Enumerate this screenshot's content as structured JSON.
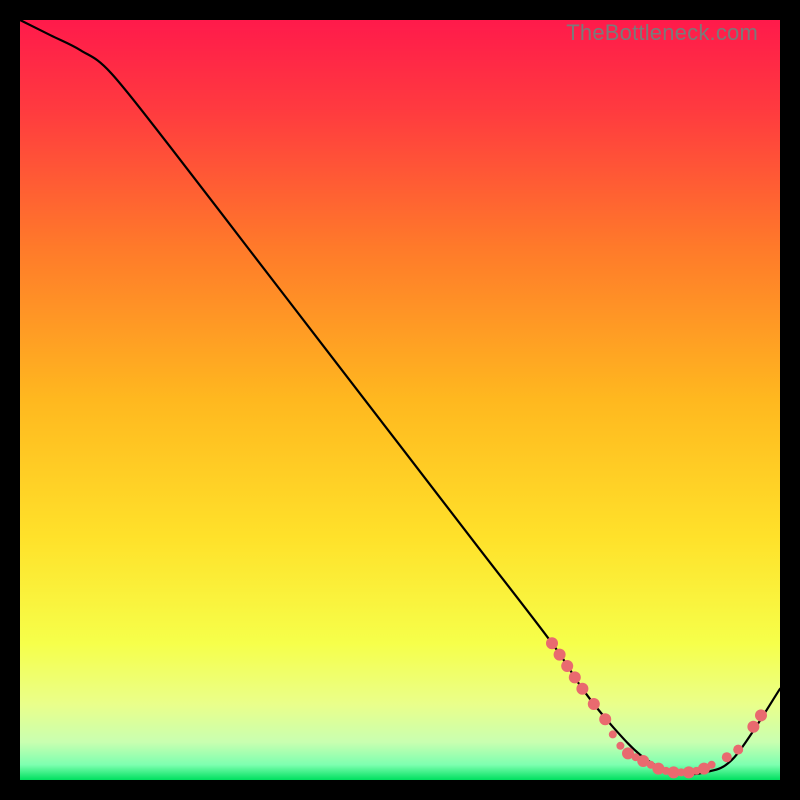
{
  "watermark": "TheBottleneck.com",
  "chart_data": {
    "type": "line",
    "title": "",
    "xlabel": "",
    "ylabel": "",
    "xlim": [
      0,
      100
    ],
    "ylim": [
      0,
      100
    ],
    "grid": false,
    "legend": false,
    "background_gradient": {
      "top_color": "#ff1a4b",
      "mid_color": "#ffd400",
      "bottom_band_color": "#eaff8a",
      "bottom_edge_color": "#00e060"
    },
    "series": [
      {
        "name": "curve",
        "color": "#000000",
        "x": [
          0,
          4,
          8,
          12,
          20,
          30,
          40,
          50,
          60,
          70,
          74,
          78,
          82,
          86,
          90,
          94,
          100
        ],
        "y": [
          100,
          98,
          96,
          93,
          83,
          70,
          57,
          44,
          31,
          18,
          12,
          7,
          3,
          1,
          1,
          3,
          12
        ]
      }
    ],
    "markers": [
      {
        "name": "dots",
        "color": "#e96a6f",
        "size_small": 4,
        "size_large": 6,
        "points": [
          {
            "x": 70.0,
            "y": 18.0,
            "r": 6
          },
          {
            "x": 71.0,
            "y": 16.5,
            "r": 6
          },
          {
            "x": 72.0,
            "y": 15.0,
            "r": 6
          },
          {
            "x": 73.0,
            "y": 13.5,
            "r": 6
          },
          {
            "x": 74.0,
            "y": 12.0,
            "r": 6
          },
          {
            "x": 75.5,
            "y": 10.0,
            "r": 6
          },
          {
            "x": 77.0,
            "y": 8.0,
            "r": 6
          },
          {
            "x": 78.0,
            "y": 6.0,
            "r": 4
          },
          {
            "x": 79.0,
            "y": 4.5,
            "r": 4
          },
          {
            "x": 80.0,
            "y": 3.5,
            "r": 6
          },
          {
            "x": 81.0,
            "y": 3.0,
            "r": 4
          },
          {
            "x": 82.0,
            "y": 2.5,
            "r": 6
          },
          {
            "x": 83.0,
            "y": 2.0,
            "r": 4
          },
          {
            "x": 84.0,
            "y": 1.5,
            "r": 6
          },
          {
            "x": 85.0,
            "y": 1.2,
            "r": 4
          },
          {
            "x": 86.0,
            "y": 1.0,
            "r": 6
          },
          {
            "x": 87.0,
            "y": 1.0,
            "r": 4
          },
          {
            "x": 88.0,
            "y": 1.0,
            "r": 6
          },
          {
            "x": 89.0,
            "y": 1.2,
            "r": 4
          },
          {
            "x": 90.0,
            "y": 1.5,
            "r": 6
          },
          {
            "x": 91.0,
            "y": 2.0,
            "r": 4
          },
          {
            "x": 93.0,
            "y": 3.0,
            "r": 5
          },
          {
            "x": 94.5,
            "y": 4.0,
            "r": 5
          },
          {
            "x": 96.5,
            "y": 7.0,
            "r": 6
          },
          {
            "x": 97.5,
            "y": 8.5,
            "r": 6
          }
        ]
      }
    ]
  }
}
